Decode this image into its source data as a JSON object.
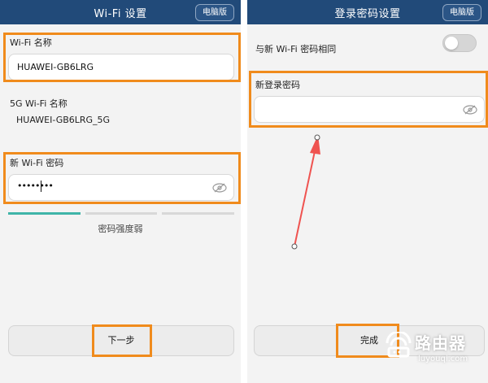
{
  "left_screen": {
    "title": "Wi-Fi 设置",
    "pc_button": "电脑版",
    "wifi_name_label": "Wi-Fi 名称",
    "wifi_name_value": "HUAWEI-GB6LRG",
    "wifi5g_label": "5G Wi-Fi 名称",
    "wifi5g_value": "HUAWEI-GB6LRG_5G",
    "new_password_label": "新 Wi-Fi 密码",
    "new_password_value": "••••••••",
    "strength_label": "密码强度弱",
    "strength_level": "1/3",
    "next_button": "下一步"
  },
  "right_screen": {
    "title": "登录密码设置",
    "pc_button": "电脑版",
    "same_as_wifi_label": "与新 Wi-Fi 密码相同",
    "same_as_wifi_toggle": "off",
    "new_login_label": "新登录密码",
    "new_login_value": "",
    "done_button": "完成"
  },
  "watermark": {
    "main": "路由器",
    "sub": "luyouqi.com"
  },
  "colors": {
    "topbar": "#214a79",
    "highlight": "#f08b1c",
    "arrow": "#ef5350",
    "strength": "#3fb4a8"
  },
  "icons": [
    "eye-icon",
    "router-logo-icon"
  ]
}
